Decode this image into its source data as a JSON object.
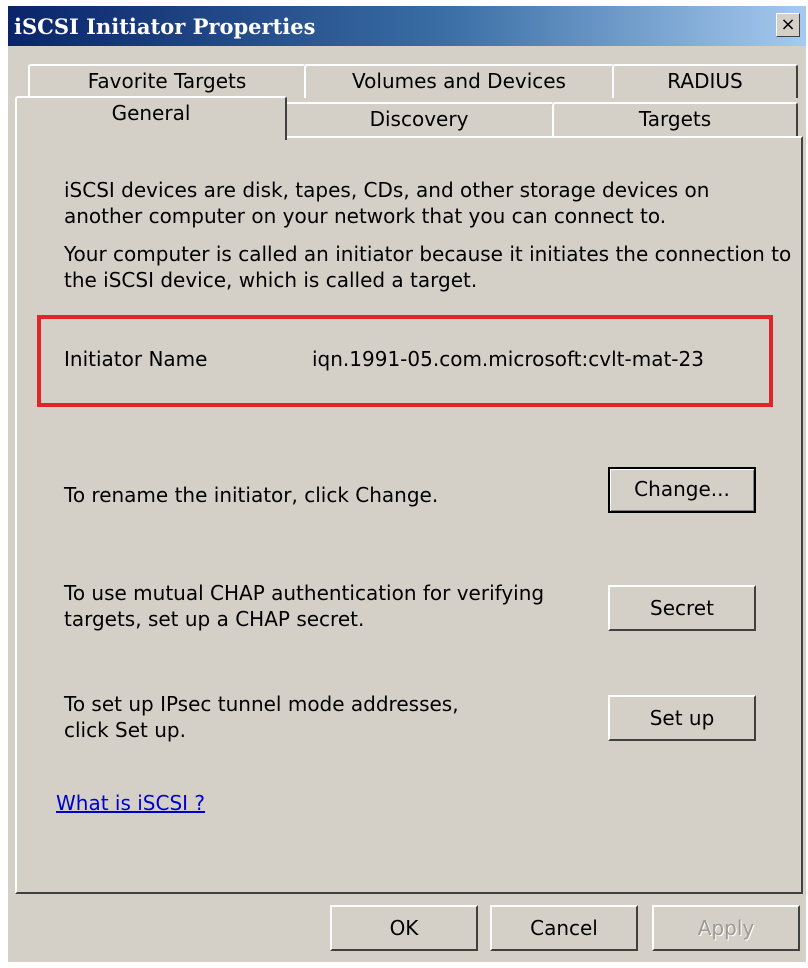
{
  "window": {
    "title": "iSCSI Initiator Properties",
    "close_glyph": "×"
  },
  "tabs": {
    "row_back": [
      "Favorite Targets",
      "Volumes and Devices",
      "RADIUS"
    ],
    "row_front": [
      "General",
      "Discovery",
      "Targets"
    ],
    "active": "General"
  },
  "general": {
    "intro1_line1": "iSCSI devices are disk, tapes, CDs, and other storage devices on",
    "intro1_line2": "another computer on your network that you can connect to.",
    "intro2_line1": "Your computer is called an initiator because it initiates the connection to",
    "intro2_line2": "the iSCSI device, which is called a target.",
    "initiator_label": "Initiator Name",
    "initiator_value": "iqn.1991-05.com.microsoft:cvlt-mat-23",
    "rename_text": "To rename the initiator, click Change.",
    "change_button": "Change...",
    "chap_line1": "To use mutual CHAP authentication for verifying",
    "chap_line2": "targets, set up a CHAP secret.",
    "secret_button": "Secret",
    "ipsec_line1": "To set up IPsec tunnel mode addresses,",
    "ipsec_line2": "click Set up.",
    "setup_button": "Set up",
    "help_link": "What is iSCSI ?"
  },
  "footer": {
    "ok": "OK",
    "cancel": "Cancel",
    "apply": "Apply"
  },
  "colors": {
    "dialog_face": "#d4d0c8",
    "title_start": "#0a246a",
    "title_end": "#a6caf0",
    "highlight_box": "#e0242a",
    "link": "#0000cc"
  }
}
